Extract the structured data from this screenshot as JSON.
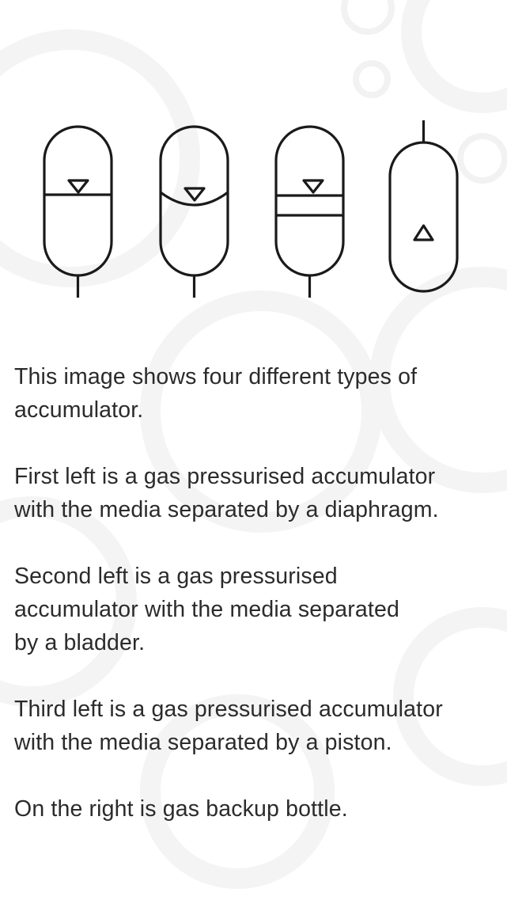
{
  "diagram": {
    "symbols": [
      {
        "name": "diaphragm-accumulator",
        "gas_marker_icon": "triangle-down-icon"
      },
      {
        "name": "bladder-accumulator",
        "gas_marker_icon": "triangle-down-icon"
      },
      {
        "name": "piston-accumulator",
        "gas_marker_icon": "triangle-down-icon"
      },
      {
        "name": "gas-backup-bottle",
        "gas_marker_icon": "triangle-up-icon"
      }
    ],
    "stroke_color": "#1a1a1a",
    "background_pattern_icon": "gear-icon"
  },
  "description": {
    "paragraphs": [
      "This image shows four different types of\naccumulator.",
      "First left is a gas pressurised accumulator\nwith the media separated by a diaphragm.",
      "Second left is a gas pressurised\naccumulator with the media separated\nby a bladder.",
      "Third left is a gas pressurised accumulator\nwith the media separated by a piston.",
      "On the right is gas backup bottle."
    ]
  }
}
